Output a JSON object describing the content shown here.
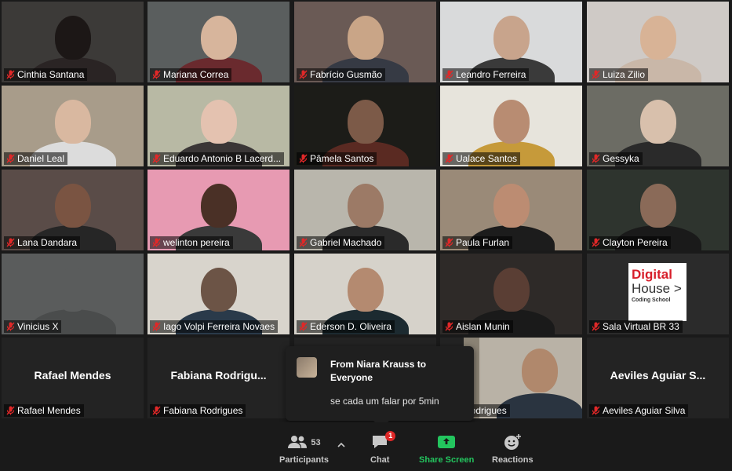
{
  "colors": {
    "accent_share": "#23c55e",
    "mic_muted": "#e02828",
    "chat_badge": "#e02828",
    "brand_red": "#d71e2a"
  },
  "participants": [
    {
      "name": "Cinthia Santana"
    },
    {
      "name": "Mariana Correa"
    },
    {
      "name": "Fabrício Gusmão"
    },
    {
      "name": "Leandro Ferreira"
    },
    {
      "name": "Luiza Zilio"
    },
    {
      "name": "Daniel Leal"
    },
    {
      "name": "Eduardo Antonio B Lacerd..."
    },
    {
      "name": "Pâmela Santos"
    },
    {
      "name": "Ualace Santos"
    },
    {
      "name": "Gessyka"
    },
    {
      "name": "Lana Dandara"
    },
    {
      "name": "welinton pereira"
    },
    {
      "name": "Gabriel Machado"
    },
    {
      "name": "Paula Furlan"
    },
    {
      "name": "Clayton Pereira"
    },
    {
      "name": "Vinicius X"
    },
    {
      "name": "Iago Volpi Ferreira Novaes"
    },
    {
      "name": "Ederson D. Oliveira"
    },
    {
      "name": "Aislan Munin"
    },
    {
      "name": "Sala Virtual BR 33"
    },
    {
      "name": "Rafael Mendes",
      "big": "Rafael Mendes"
    },
    {
      "name": "Fabiana Rodrigues",
      "big": "Fabiana  Rodrigu..."
    },
    {
      "name": ""
    },
    {
      "name": "d Rodrigues"
    },
    {
      "name": "Aeviles Aguiar Silva",
      "big": "Aeviles  Aguiar  S..."
    }
  ],
  "logo": {
    "line1": "Digital",
    "line2": "House >",
    "line3": "Coding School"
  },
  "chat_popup": {
    "from": "From Niara Krauss to Everyone",
    "message": "se cada um falar por 5min"
  },
  "toolbar": {
    "participants": {
      "label": "Participants",
      "count": "53"
    },
    "chat": {
      "label": "Chat",
      "badge": "1"
    },
    "share": {
      "label": "Share Screen"
    },
    "reactions": {
      "label": "Reactions"
    }
  }
}
